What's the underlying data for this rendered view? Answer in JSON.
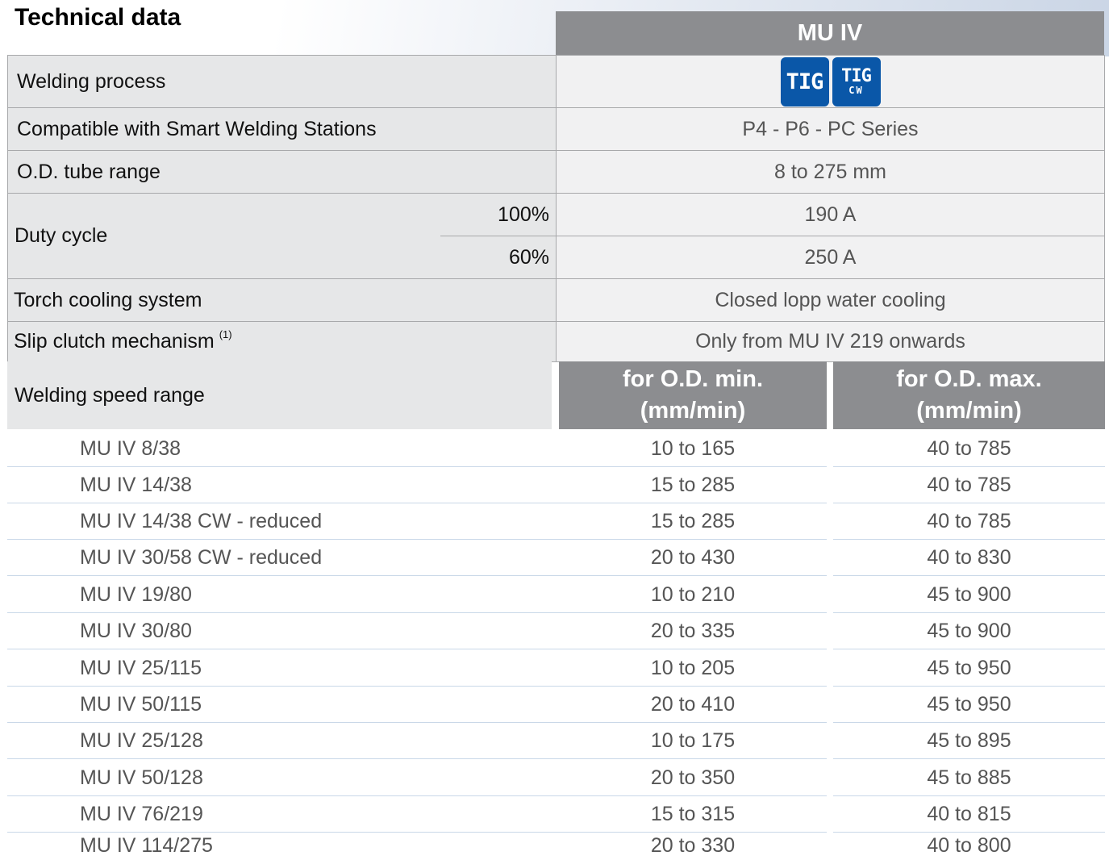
{
  "title": "Technical data",
  "product": "MU IV",
  "rows": {
    "welding_process": {
      "label": "Welding process",
      "icons": [
        {
          "icon": "tig-icon",
          "text": "TIG",
          "color": "#0a57a8"
        },
        {
          "icon": "tig-cw-icon",
          "text": "TIG",
          "subtext": "CW",
          "color": "#0a57a8"
        }
      ]
    },
    "compatible": {
      "label": "Compatible with Smart Welding Stations",
      "value": "P4 -  P6 - PC Series"
    },
    "od_range": {
      "label": "O.D. tube range",
      "value": "8 to 275 mm"
    },
    "duty_cycle": {
      "label": "Duty cycle",
      "levels": [
        {
          "pct": "100%",
          "value": "190 A"
        },
        {
          "pct": "60%",
          "value": "250 A"
        }
      ]
    },
    "cooling": {
      "label": "Torch cooling system",
      "value": "Closed lopp water cooling"
    },
    "slip_clutch": {
      "label": "Slip clutch mechanism",
      "footnote": "(1)",
      "value": "Only from MU IV 219 onwards"
    }
  },
  "speed": {
    "label": "Welding speed range",
    "col_min": {
      "line1": "for O.D. min.",
      "line2": "(mm/min)"
    },
    "col_max": {
      "line1": "for O.D. max.",
      "line2": "(mm/min)"
    },
    "models": [
      {
        "name": "MU IV 8/38",
        "min": "10 to 165",
        "max": "40 to 785"
      },
      {
        "name": "MU IV 14/38",
        "min": "15 to 285",
        "max": "40 to 785"
      },
      {
        "name": "MU IV 14/38 CW - reduced",
        "min": "15 to 285",
        "max": "40 to 785"
      },
      {
        "name": "MU IV 30/58 CW - reduced",
        "min": "20 to 430",
        "max": "40 to 830"
      },
      {
        "name": "MU IV 19/80",
        "min": "10 to 210",
        "max": "45 to 900"
      },
      {
        "name": "MU IV 30/80",
        "min": "20 to 335",
        "max": "45 to 900"
      },
      {
        "name": "MU IV 25/115",
        "min": "10 to 205",
        "max": "45 to 950"
      },
      {
        "name": "MU IV 50/115",
        "min": "20 to 410",
        "max": "45 to 950"
      },
      {
        "name": "MU IV 25/128",
        "min": "10 to 175",
        "max": "45 to 895"
      },
      {
        "name": "MU IV 50/128",
        "min": "20 to 350",
        "max": "45 to 885"
      },
      {
        "name": "MU IV 76/219",
        "min": "15 to 315",
        "max": "40 to 815"
      },
      {
        "name": "MU IV 114/275",
        "min": "20 to 330",
        "max": "40 to 800"
      }
    ]
  }
}
